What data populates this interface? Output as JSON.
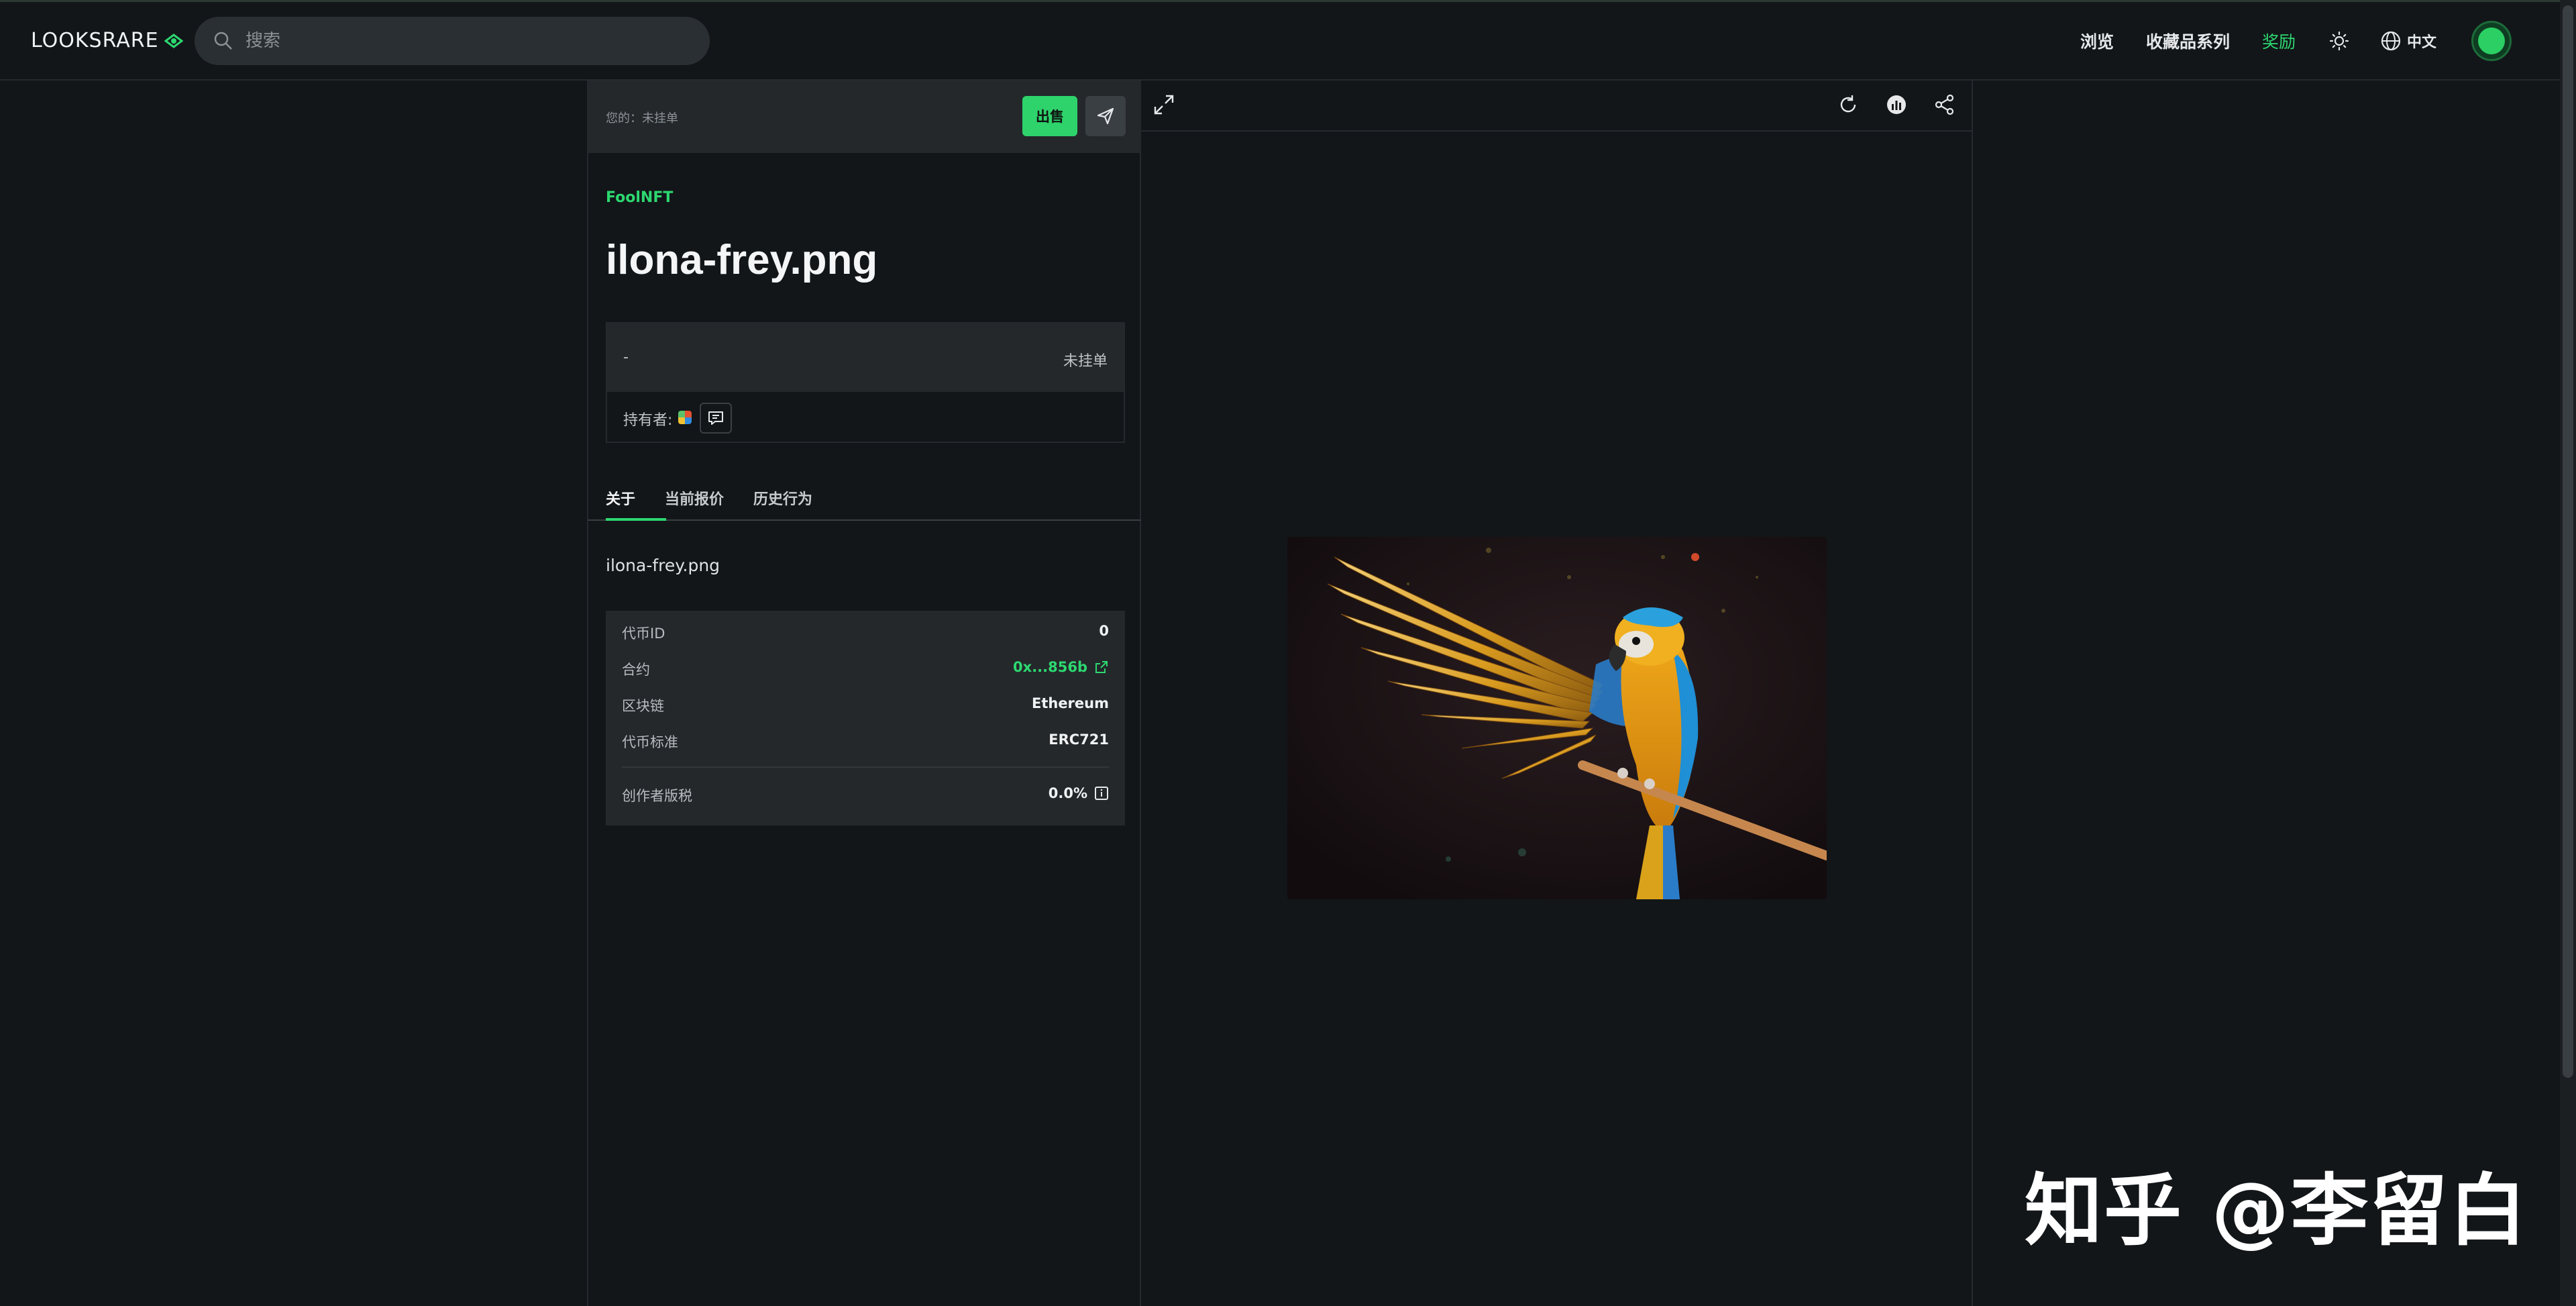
{
  "header": {
    "logo_text": "LOOKSRARE",
    "search_placeholder": "搜索",
    "nav": {
      "browse": "浏览",
      "collections": "收藏品系列",
      "rewards": "奖励",
      "language": "中文"
    }
  },
  "owner_bar": {
    "status": "您的：未挂单",
    "sell_label": "出售"
  },
  "item": {
    "collection": "FoolNFT",
    "title": "ilona-frey.png",
    "price": "-",
    "listing_status": "未挂单",
    "holder_label": "持有者:"
  },
  "tabs": [
    {
      "label": "关于",
      "active": true
    },
    {
      "label": "当前报价",
      "active": false
    },
    {
      "label": "历史行为",
      "active": false
    }
  ],
  "about": {
    "description": "ilona-frey.png",
    "details": {
      "token_id_label": "代币ID",
      "token_id": "0",
      "contract_label": "合约",
      "contract": "0x...856b",
      "chain_label": "区块链",
      "chain": "Ethereum",
      "standard_label": "代币标准",
      "standard": "ERC721",
      "royalty_label": "创作者版税",
      "royalty": "0.0%"
    }
  },
  "media_toolbar": {
    "icons": [
      "expand-icon",
      "refresh-icon",
      "stats-icon",
      "share-icon"
    ]
  },
  "watermark": "知乎 @李留白",
  "colors": {
    "accent": "#2dd870",
    "background": "#121619",
    "panel": "#24282b"
  }
}
